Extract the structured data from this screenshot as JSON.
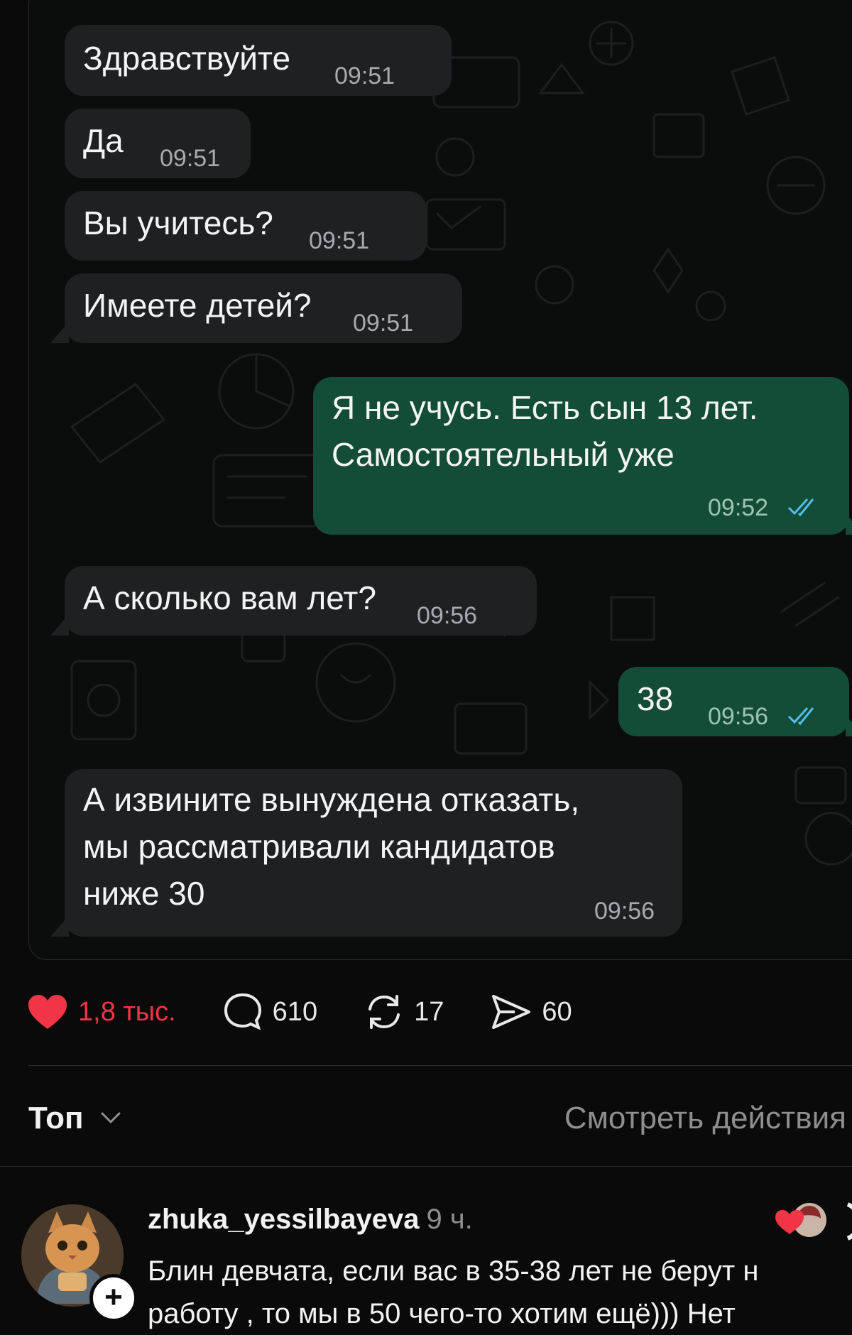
{
  "chat": {
    "messages": [
      {
        "direction": "in",
        "text": "Здравствуйте",
        "time": "09:51"
      },
      {
        "direction": "in",
        "text": "Да",
        "time": "09:51"
      },
      {
        "direction": "in",
        "text": "Вы учитесь?",
        "time": "09:51"
      },
      {
        "direction": "in",
        "text": "Имеете детей?",
        "time": "09:51"
      },
      {
        "direction": "out",
        "text": "Я не учусь. Есть сын 13 лет.\nСамостоятельный уже",
        "time": "09:52",
        "status": "read"
      },
      {
        "direction": "in",
        "text": "А сколько вам лет?",
        "time": "09:56"
      },
      {
        "direction": "out",
        "text": "38",
        "time": "09:56",
        "status": "read"
      },
      {
        "direction": "in",
        "text": "А извините вынуждена отказать,\nмы рассматривали кандидатов\nниже 30",
        "time": "09:56"
      }
    ]
  },
  "stats": {
    "likes": "1,8 тыс.",
    "comments": "610",
    "reposts": "17",
    "shares": "60"
  },
  "sort": {
    "label": "Топ",
    "view_activity": "Смотреть действия"
  },
  "comment": {
    "username": "zhuka_yessilbayeva",
    "age": "9 ч.",
    "text_line1": "Блин девчата, если вас в 35-38 лет не берут н",
    "text_line2": "работу , то мы  в 50 чего-то хотим ещё))) Нет"
  },
  "colors": {
    "incoming_bubble": "#1f2022",
    "outgoing_bubble": "#144d37",
    "like_red": "#f23447",
    "read_ticks": "#53bdeb"
  }
}
